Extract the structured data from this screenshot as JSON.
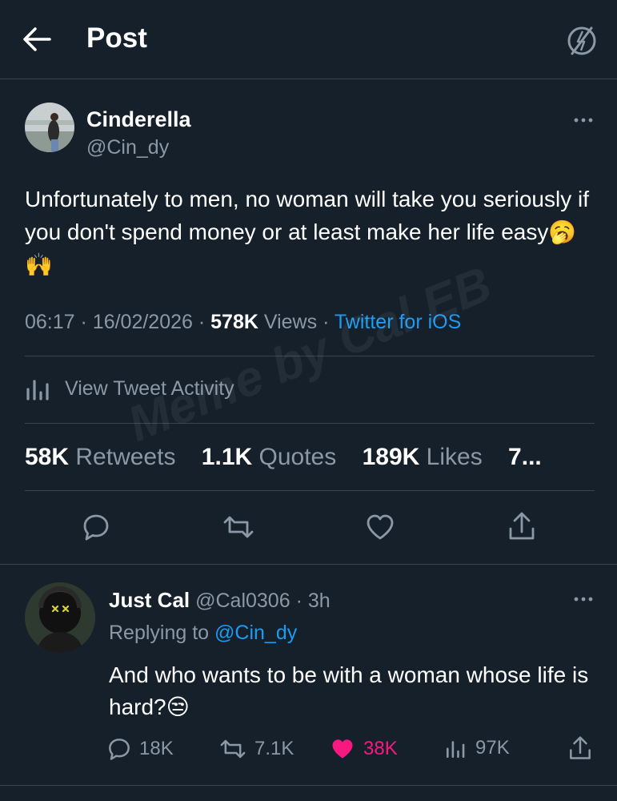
{
  "header": {
    "title": "Post"
  },
  "tweet": {
    "author_name": "Cinderella",
    "author_handle": "@Cin_dy",
    "text": "Unfortunately to men, no woman will take you seriously if you don't spend money or at least make her life easy🥱🙌",
    "time": "06:17",
    "date": "16/02/2026",
    "views_count": "578K",
    "views_label": "Views",
    "client": "Twitter for iOS",
    "activity_label": "View Tweet Activity",
    "stats": {
      "retweets": "58K",
      "retweets_label": "Retweets",
      "quotes": "1.1K",
      "quotes_label": "Quotes",
      "likes": "189K",
      "likes_label": "Likes",
      "more": "7..."
    }
  },
  "watermark": "Meme by Cal EB",
  "reply": {
    "author_name": "Just Cal",
    "author_handle": "@Cal0306",
    "time": "3h",
    "replying_prefix": "Replying to",
    "replying_handle": "@Cin_dy",
    "text": "And who wants to be with a woman whose life is hard?😒",
    "replies": "18K",
    "retweets": "7.1K",
    "likes": "38K",
    "views": "97K"
  },
  "colors": {
    "background": "#15202b",
    "accent": "#1d9bf0",
    "like": "#f91880",
    "muted": "#8b98a5"
  }
}
